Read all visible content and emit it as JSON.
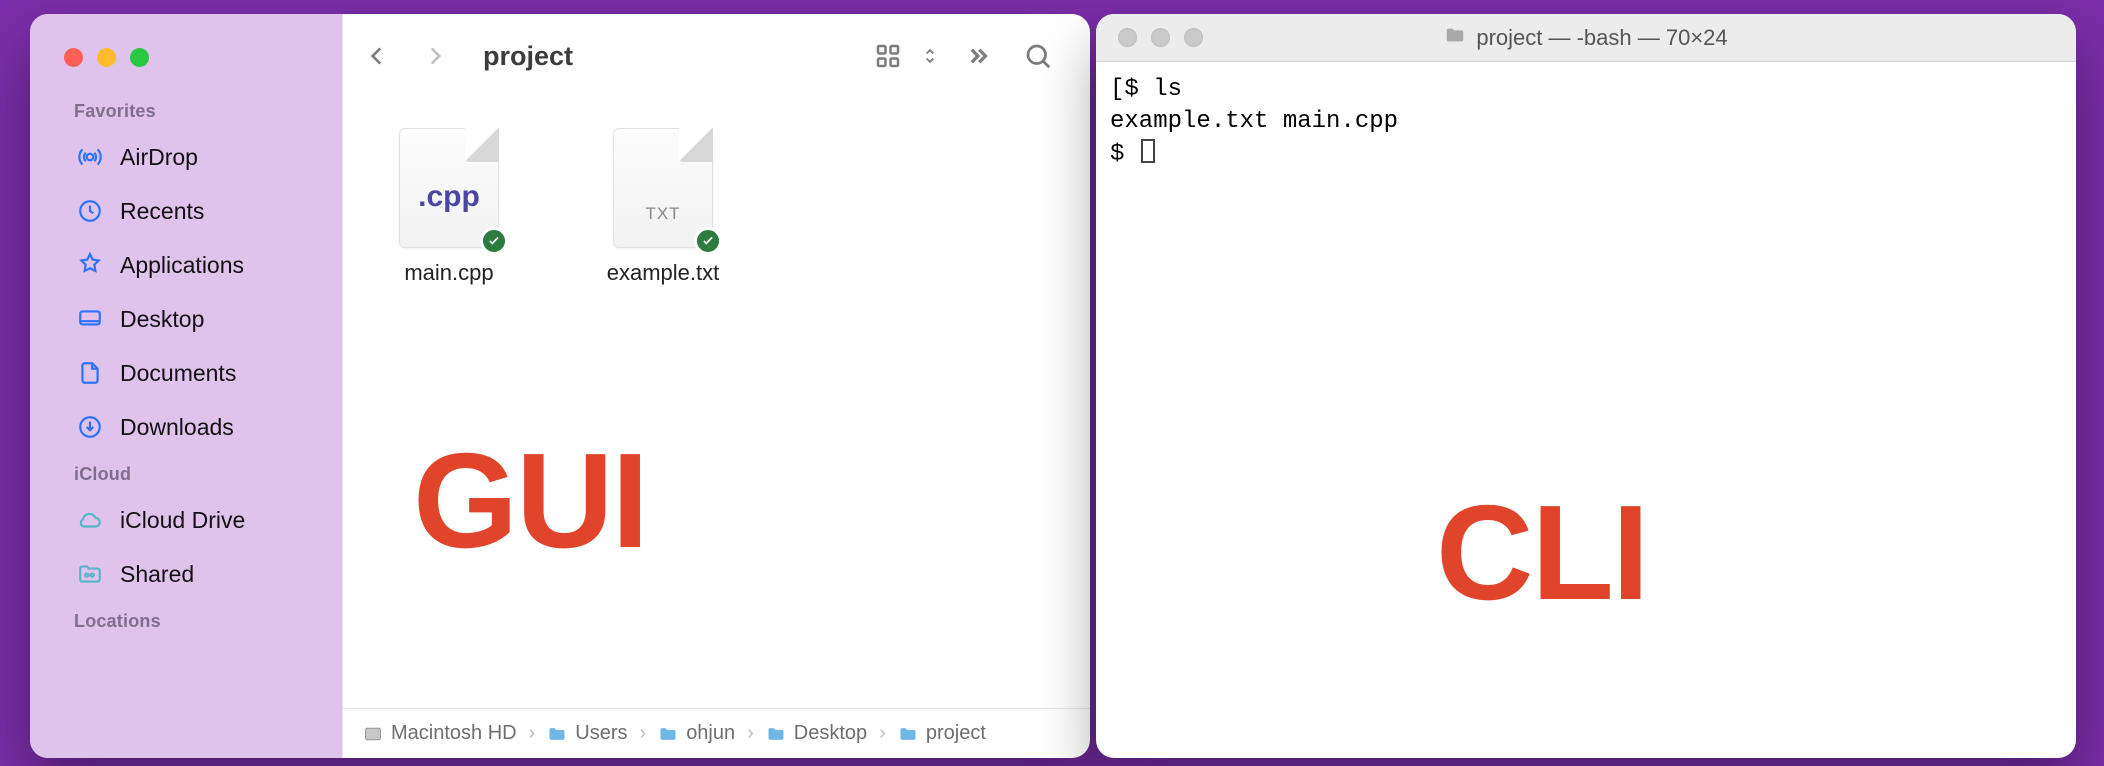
{
  "overlay": {
    "gui": "GUI",
    "cli": "CLI"
  },
  "finder": {
    "title": "project",
    "sidebar": {
      "sections": {
        "favorites": "Favorites",
        "icloud": "iCloud",
        "locations": "Locations"
      },
      "favorites": [
        {
          "icon": "airdrop",
          "label": "AirDrop"
        },
        {
          "icon": "recents",
          "label": "Recents"
        },
        {
          "icon": "applications",
          "label": "Applications"
        },
        {
          "icon": "desktop",
          "label": "Desktop"
        },
        {
          "icon": "documents",
          "label": "Documents"
        },
        {
          "icon": "downloads",
          "label": "Downloads"
        }
      ],
      "icloud": [
        {
          "icon": "icloud",
          "label": "iCloud Drive"
        },
        {
          "icon": "shared",
          "label": "Shared"
        }
      ]
    },
    "files": [
      {
        "name": "main.cpp",
        "ext": ".cpp",
        "type": "cpp",
        "synced": true
      },
      {
        "name": "example.txt",
        "ext": "TXT",
        "type": "txt",
        "synced": true
      }
    ],
    "pathbar": [
      {
        "icon": "disk",
        "label": "Macintosh HD"
      },
      {
        "icon": "folder",
        "label": "Users"
      },
      {
        "icon": "folder",
        "label": "ohjun"
      },
      {
        "icon": "folder",
        "label": "Desktop"
      },
      {
        "icon": "folder",
        "label": "project"
      }
    ]
  },
  "terminal": {
    "title": "project — -bash — 70×24",
    "lines": [
      "[$ ls",
      "example.txt main.cpp",
      "$ "
    ]
  }
}
